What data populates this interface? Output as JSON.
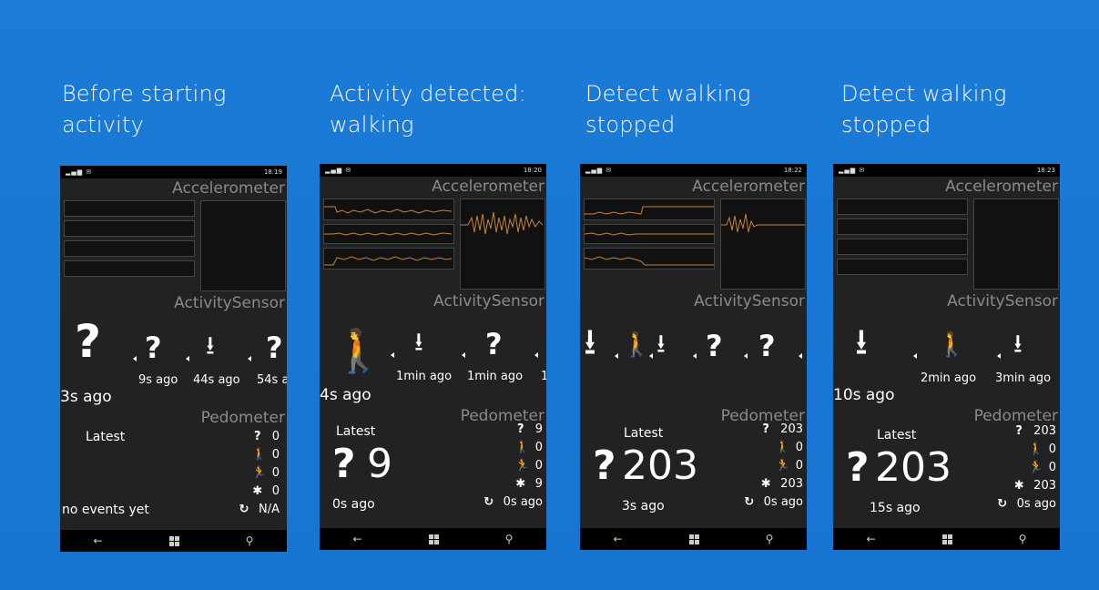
{
  "captions": [
    {
      "line1": "Before starting",
      "line2": "activity"
    },
    {
      "line1": "Activity detected:",
      "line2": "walking"
    },
    {
      "line1": "Detect walking",
      "line2": "stopped"
    },
    {
      "line1": "Detect walking",
      "line2": "stopped"
    }
  ],
  "phones": [
    {
      "time": "18:19",
      "accelerometer_title": "Accelerometer",
      "activity_title": "ActivitySensor",
      "pedometer_title": "Pedometer",
      "current_ago": "3s ago",
      "history_ago": [
        "9s ago",
        "44s ago",
        "54s a"
      ],
      "latest_label": "Latest",
      "latest_value": "",
      "latest_ago": "no events yet",
      "stats": {
        "unknown": "0",
        "walk": "0",
        "run": "0",
        "total": "0",
        "refresh": "N/A"
      }
    },
    {
      "time": "18:20",
      "accelerometer_title": "Accelerometer",
      "activity_title": "ActivitySensor",
      "pedometer_title": "Pedometer",
      "current_ago": "4s ago",
      "history_ago": [
        "1min ago",
        "1min ago",
        "1"
      ],
      "latest_label": "Latest",
      "latest_value": "9",
      "latest_ago": "0s ago",
      "stats": {
        "unknown": "9",
        "walk": "0",
        "run": "0",
        "total": "9",
        "refresh": "0s ago"
      }
    },
    {
      "time": "18:22",
      "accelerometer_title": "Accelerometer",
      "activity_title": "ActivitySensor",
      "pedometer_title": "Pedometer",
      "current_ago": "",
      "history_ago": [],
      "latest_label": "Latest",
      "latest_value": "203",
      "latest_ago": "3s ago",
      "stats": {
        "unknown": "203",
        "walk": "0",
        "run": "0",
        "total": "203",
        "refresh": "0s ago"
      }
    },
    {
      "time": "18:23",
      "accelerometer_title": "Accelerometer",
      "activity_title": "ActivitySensor",
      "pedometer_title": "Pedometer",
      "current_ago": "10s ago",
      "history_ago": [
        "2min ago",
        "3min ago"
      ],
      "latest_label": "Latest",
      "latest_value": "203",
      "latest_ago": "15s ago",
      "stats": {
        "unknown": "203",
        "walk": "0",
        "run": "0",
        "total": "203",
        "refresh": "0s ago"
      }
    }
  ],
  "icons": {
    "unknown": "question-icon",
    "stationary": "stationary-down-arrow-icon",
    "walking": "walking-person-icon",
    "running": "running-person-icon",
    "total": "asterisk-icon",
    "refresh": "refresh-icon",
    "back": "back-arrow-icon",
    "windows": "windows-logo-icon",
    "search": "search-icon"
  },
  "colors": {
    "background": "#1976d2",
    "phone": "#222222",
    "signal": "#c8823a"
  }
}
